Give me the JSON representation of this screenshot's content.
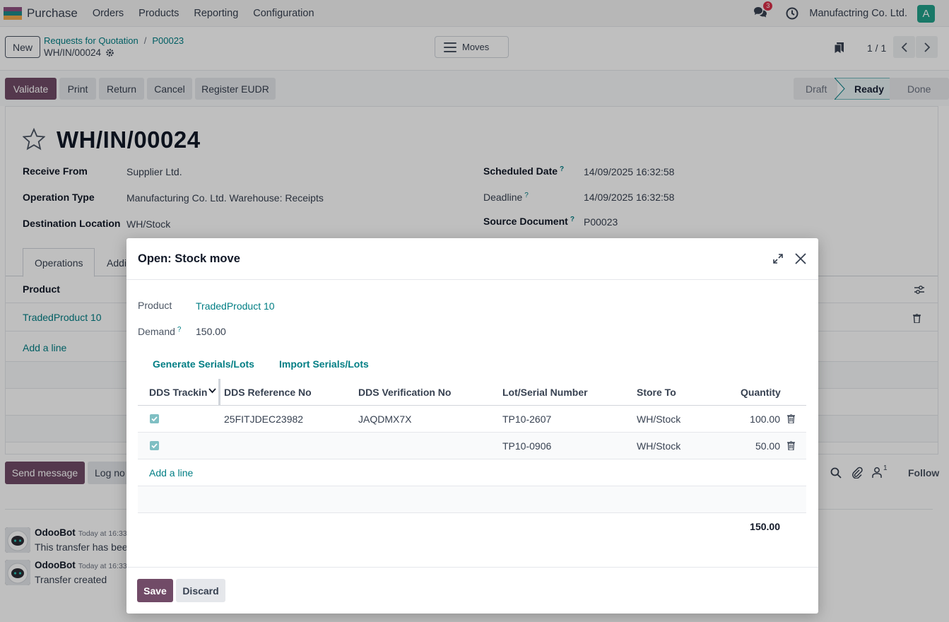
{
  "navbar": {
    "app_name": "Purchase",
    "menu": [
      "Orders",
      "Products",
      "Reporting",
      "Configuration"
    ],
    "chat_badge": "3",
    "company": "Manufactring Co. Ltd.",
    "avatar_initial": "A",
    "apps_icon_colors": [
      "#8f5181",
      "#1e8a8a",
      "#f0a84b"
    ]
  },
  "control": {
    "new_label": "New",
    "breadcrumb": [
      "Requests for Quotation",
      "P00023"
    ],
    "breadcrumb_sep": "/",
    "record_name": "WH/IN/00024",
    "moves_label": "Moves",
    "pager": "1 / 1"
  },
  "actions": {
    "validate": "Validate",
    "print": "Print",
    "return": "Return",
    "cancel": "Cancel",
    "register_eudr": "Register EUDR",
    "stages": [
      "Draft",
      "Ready",
      "Done"
    ],
    "active_stage": "Ready"
  },
  "form": {
    "title": "WH/IN/00024",
    "receive_from_label": "Receive From",
    "receive_from": "Supplier Ltd.",
    "operation_type_label": "Operation Type",
    "operation_type": "Manufacturing Co. Ltd. Warehouse: Receipts",
    "destination_label": "Destination Location",
    "destination": "WH/Stock",
    "scheduled_date_label": "Scheduled Date",
    "scheduled_date": "14/09/2025 16:32:58",
    "deadline_label": "Deadline",
    "deadline": "14/09/2025 16:32:58",
    "source_document_label": "Source Document",
    "source_document": "P00023",
    "help_mark": "?",
    "tabs": [
      "Operations",
      "Addi"
    ],
    "product_col": "Product",
    "product_line": "TradedProduct 10",
    "add_line": "Add a line"
  },
  "chatter": {
    "send_message": "Send message",
    "log_note": "Log no",
    "follow": "Follow",
    "followers_count": "1",
    "messages": [
      {
        "author": "OdooBot",
        "time": "Today at 16:33",
        "body": "This transfer has been"
      },
      {
        "author": "OdooBot",
        "time": "Today at 16:33",
        "body": "Transfer created"
      }
    ]
  },
  "modal": {
    "title": "Open: Stock move",
    "product_label": "Product",
    "product": "TradedProduct 10",
    "demand_label": "Demand",
    "demand": "150.00",
    "help_mark": "?",
    "generate_btn": "Generate Serials/Lots",
    "import_btn": "Import Serials/Lots",
    "columns": [
      "DDS Tracking",
      "DDS Reference No",
      "DDS Verification No",
      "Lot/Serial Number",
      "Store To",
      "Quantity"
    ],
    "rows": [
      {
        "dds_tracking": true,
        "dds_ref": "25FITJDEC23982",
        "dds_verif": "JAQDMX7X",
        "lot": "TP10-2607",
        "store": "WH/Stock",
        "qty": "100.00"
      },
      {
        "dds_tracking": true,
        "dds_ref": "",
        "dds_verif": "",
        "lot": "TP10-0906",
        "store": "WH/Stock",
        "qty": "50.00"
      }
    ],
    "add_line": "Add a line",
    "total": "150.00",
    "save": "Save",
    "discard": "Discard"
  },
  "colors": {
    "primary": "#714b67",
    "link": "#017e84",
    "badge": "#d9304a",
    "avatar": "#22a08a"
  }
}
